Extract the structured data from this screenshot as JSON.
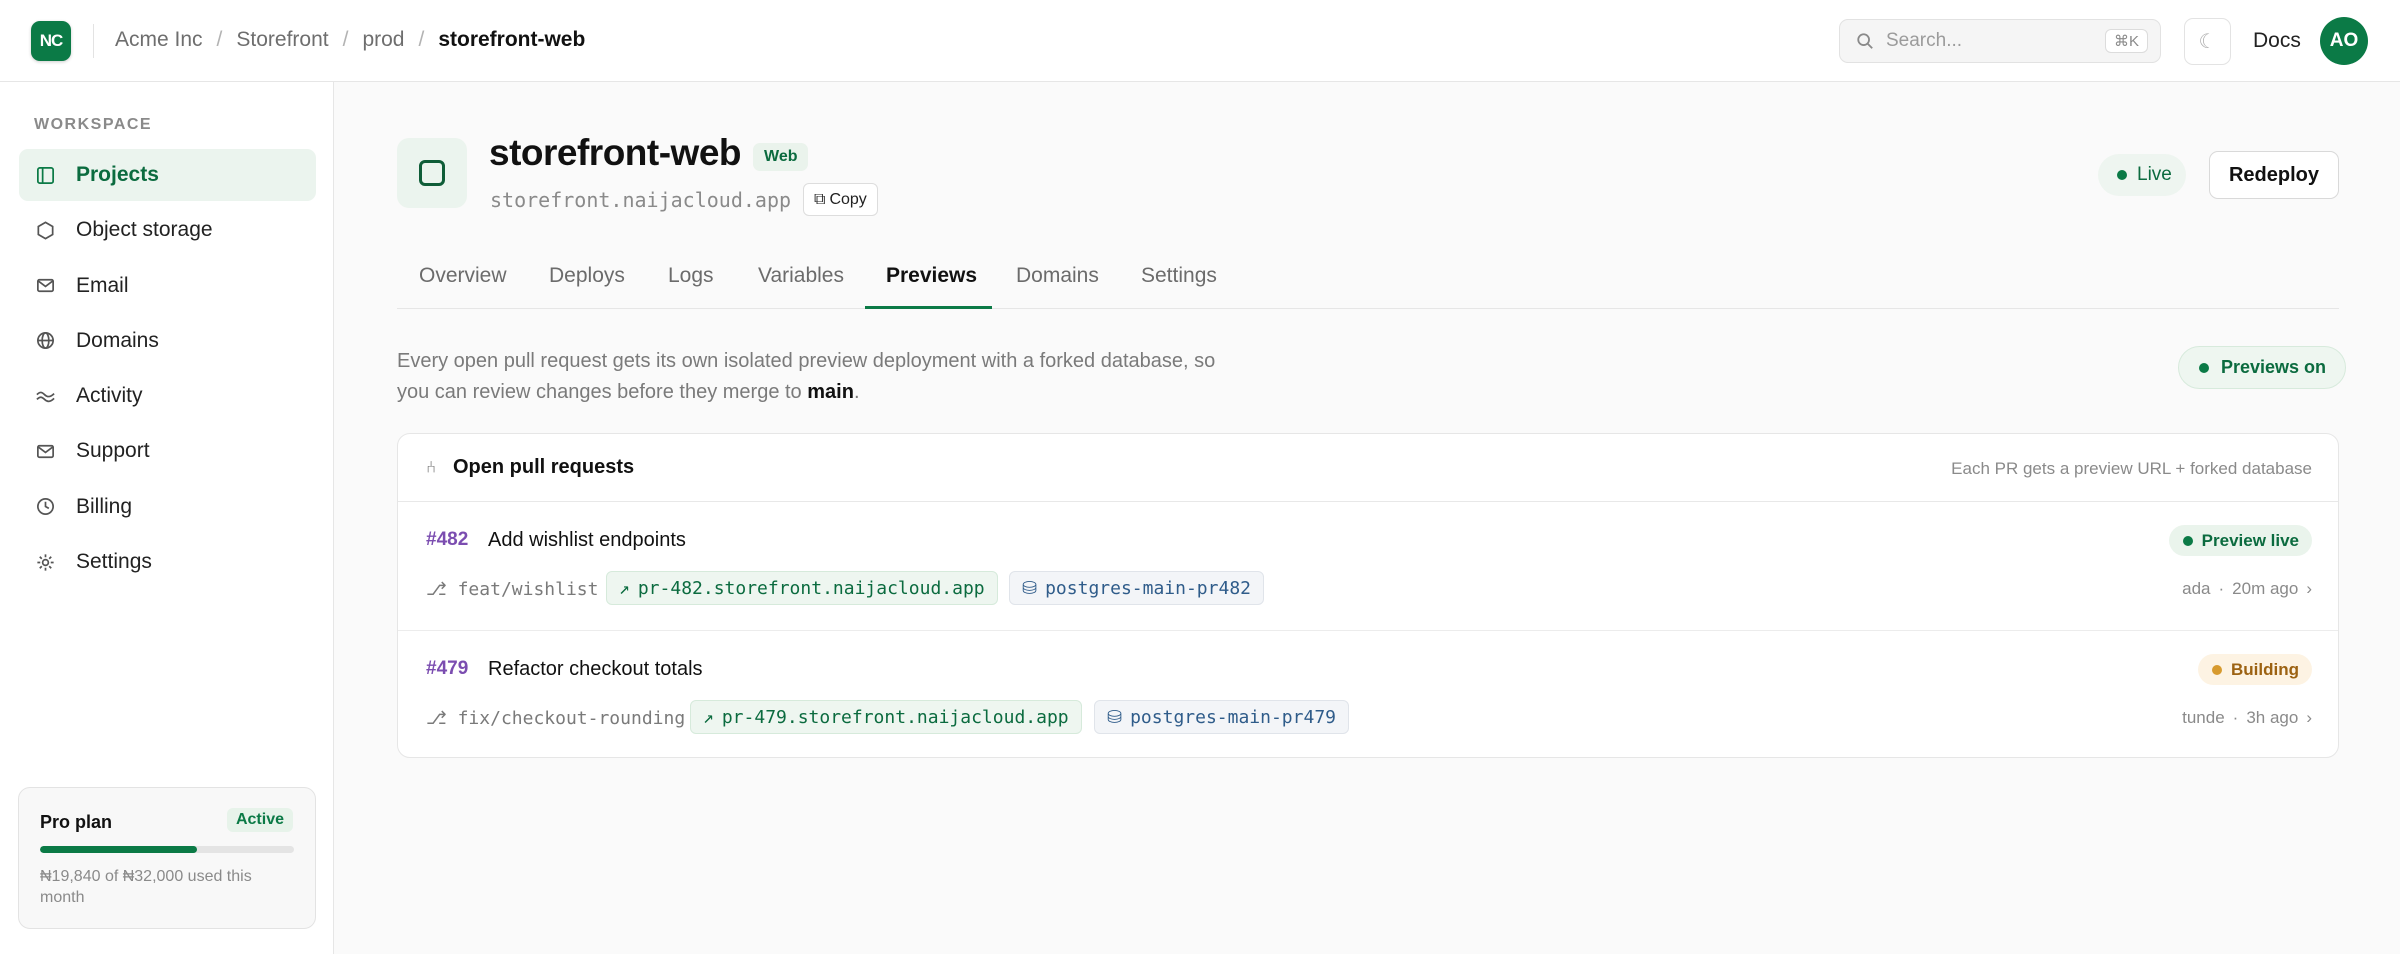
{
  "header": {
    "logo_text": "NC",
    "breadcrumbs": [
      "Acme Inc",
      "Storefront",
      "prod",
      "storefront-web"
    ],
    "search_placeholder": "Search...",
    "search_shortcut": "⌘K",
    "theme_icon": "moon-icon",
    "docs_label": "Docs",
    "avatar_initials": "AO"
  },
  "sidebar": {
    "section_label": "WORKSPACE",
    "items": [
      {
        "label": "Projects",
        "icon": "projects-icon",
        "active": true
      },
      {
        "label": "Object storage",
        "icon": "hexagon-icon"
      },
      {
        "label": "Email",
        "icon": "mail-icon"
      },
      {
        "label": "Domains",
        "icon": "globe-icon"
      },
      {
        "label": "Activity",
        "icon": "activity-icon"
      },
      {
        "label": "Support",
        "icon": "support-mail-icon"
      },
      {
        "label": "Billing",
        "icon": "clock-icon"
      },
      {
        "label": "Settings",
        "icon": "gear-icon"
      }
    ],
    "plan": {
      "name": "Pro plan",
      "badge": "Active",
      "usage_fraction": 0.62,
      "usage_text": "₦19,840 of ₦32,000 used this month"
    }
  },
  "project": {
    "name": "storefront-web",
    "tag": "Web",
    "url": "storefront.naijacloud.app",
    "copy_label": "Copy",
    "status": "Live",
    "redeploy_label": "Redeploy"
  },
  "tabs": [
    "Overview",
    "Deploys",
    "Logs",
    "Variables",
    "Previews",
    "Domains",
    "Settings"
  ],
  "active_tab": "Previews",
  "previews": {
    "intro_pre": "Every open pull request gets its own isolated preview deployment with a forked database, so you can review changes before they merge to",
    "intro_branch": "main",
    "intro_post": ".",
    "toggle_label": "Previews on",
    "card_title": "Open pull requests",
    "card_note": "Each PR gets a preview URL + forked database",
    "pull_requests": [
      {
        "number": "#482",
        "title": "Add wishlist endpoints",
        "branch": "feat/wishlist",
        "preview_url": "pr-482.storefront.naijacloud.app",
        "database": "postgres-main-pr482",
        "status": "Preview live",
        "author": "ada",
        "time": "20m ago"
      },
      {
        "number": "#479",
        "title": "Refactor checkout totals",
        "branch": "fix/checkout-rounding",
        "preview_url": "pr-479.storefront.naijacloud.app",
        "database": "postgres-main-pr479",
        "status": "Building",
        "author": "tunde",
        "time": "3h ago"
      }
    ]
  },
  "colors": {
    "brand": "#0b7a46",
    "pr_number": "#7b4db0",
    "building": "#d79a2e"
  }
}
